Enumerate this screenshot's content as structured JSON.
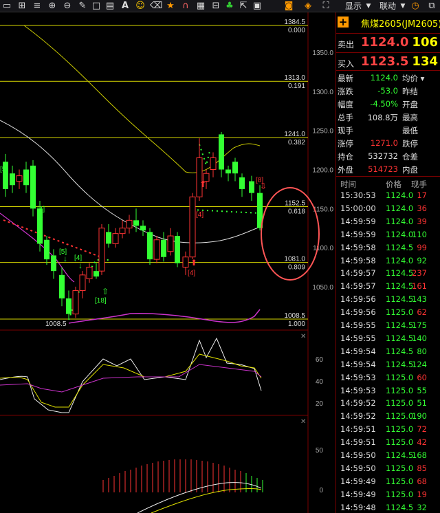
{
  "toolbar": {
    "icons": [
      "panel-icon",
      "grid-icon",
      "menu-icon",
      "zoom-in-icon",
      "zoom-out-icon",
      "pen-icon",
      "square-icon",
      "chart-icon",
      "font-icon",
      "smiley-icon",
      "eraser-icon",
      "star-icon",
      "magnet-icon",
      "calculator-icon",
      "club-icon",
      "export-icon",
      "grid-small-icon"
    ],
    "display_label": "显示",
    "link_label": "联动"
  },
  "colors": {
    "up": "#ff3333",
    "down": "#33ff33",
    "text_gray": "#dddddd",
    "yellow": "#ffff00",
    "grid": "#7a0000"
  },
  "chart": {
    "price_labels": [
      "1384.5",
      "1350.0",
      "1313.0",
      "1300.0",
      "1250.0",
      "1241.0",
      "1200.0",
      "1152.5",
      "1150.0",
      "1100.0",
      "1081.0",
      "1050.0",
      "1008.5"
    ],
    "fib_lines": [
      {
        "price": "1384.5",
        "ratio": "0.000"
      },
      {
        "price": "1313.0",
        "ratio": "0.191"
      },
      {
        "price": "1241.0",
        "ratio": "0.382"
      },
      {
        "price": "1152.5",
        "ratio": "0.618"
      },
      {
        "price": "1081.0",
        "ratio": "0.809"
      },
      {
        "price": "1008.5",
        "ratio": "1.000"
      }
    ],
    "low_label": "1008.5",
    "markers": [
      "[5]",
      "[4]",
      "[5]",
      "[4]",
      "[18]",
      "[4]",
      "[4]",
      "[8]"
    ],
    "kdj_ticks": [
      "60",
      "40",
      "20"
    ],
    "macd_ticks": [
      "50",
      "0"
    ]
  },
  "panel": {
    "title": "焦煤2605(JM2605)",
    "sell_label": "卖出",
    "sell_price": "1124.0",
    "sell_vol": "106",
    "buy_label": "买入",
    "buy_price": "1123.5",
    "buy_vol": "134",
    "stats": [
      {
        "l": "最新",
        "v": "1124.0",
        "r": "均价 ▾",
        "c": "#33ff33"
      },
      {
        "l": "涨跌",
        "v": "-53.0",
        "r": "昨结",
        "c": "#33ff33"
      },
      {
        "l": "幅度",
        "v": "-4.50%",
        "r": "开盘",
        "c": "#33ff33"
      },
      {
        "l": "总手",
        "v": "108.8万",
        "r": "最高",
        "c": "#dddddd"
      },
      {
        "l": "现手",
        "v": "",
        "r": "最低",
        "c": "#dddddd"
      },
      {
        "l": "涨停",
        "v": "1271.0",
        "r": "跌停",
        "c": "#ff3333"
      },
      {
        "l": "持仓",
        "v": "532732",
        "r": "仓差",
        "c": "#dddddd"
      },
      {
        "l": "外盘",
        "v": "514723",
        "r": "内盘",
        "c": "#ff3333"
      }
    ],
    "ticks_header": {
      "time": "时间",
      "price": "价格",
      "vol": "现手"
    },
    "ticks": [
      {
        "t": "15:30:53",
        "p": "1124.0",
        "v": "17",
        "pc": "#33ff33",
        "vc": "#ff3333"
      },
      {
        "t": "15:00:00",
        "p": "1124.0",
        "v": "36",
        "pc": "#33ff33",
        "vc": "#ff3333"
      },
      {
        "t": "14:59:59",
        "p": "1124.0",
        "v": "39",
        "pc": "#33ff33",
        "vc": "#ff3333"
      },
      {
        "t": "14:59:59",
        "p": "1124.0",
        "v": "110",
        "pc": "#33ff33",
        "vc": "#33ff33"
      },
      {
        "t": "14:59:58",
        "p": "1124.5",
        "v": "99",
        "pc": "#33ff33",
        "vc": "#ff3333"
      },
      {
        "t": "14:59:58",
        "p": "1124.0",
        "v": "92",
        "pc": "#33ff33",
        "vc": "#33ff33"
      },
      {
        "t": "14:59:57",
        "p": "1124.5",
        "v": "237",
        "pc": "#33ff33",
        "vc": "#ff3333"
      },
      {
        "t": "14:59:57",
        "p": "1124.5",
        "v": "161",
        "pc": "#33ff33",
        "vc": "#ff3333"
      },
      {
        "t": "14:59:56",
        "p": "1124.5",
        "v": "143",
        "pc": "#33ff33",
        "vc": "#33ff33"
      },
      {
        "t": "14:59:56",
        "p": "1125.0",
        "v": "62",
        "pc": "#33ff33",
        "vc": "#ff3333"
      },
      {
        "t": "14:59:55",
        "p": "1124.5",
        "v": "175",
        "pc": "#33ff33",
        "vc": "#33ff33"
      },
      {
        "t": "14:59:55",
        "p": "1124.5",
        "v": "140",
        "pc": "#33ff33",
        "vc": "#33ff33"
      },
      {
        "t": "14:59:54",
        "p": "1124.5",
        "v": "80",
        "pc": "#33ff33",
        "vc": "#33ff33"
      },
      {
        "t": "14:59:54",
        "p": "1124.5",
        "v": "124",
        "pc": "#33ff33",
        "vc": "#33ff33"
      },
      {
        "t": "14:59:53",
        "p": "1125.0",
        "v": "60",
        "pc": "#33ff33",
        "vc": "#ff3333"
      },
      {
        "t": "14:59:53",
        "p": "1125.0",
        "v": "55",
        "pc": "#33ff33",
        "vc": "#33ff33"
      },
      {
        "t": "14:59:52",
        "p": "1125.0",
        "v": "51",
        "pc": "#33ff33",
        "vc": "#33ff33"
      },
      {
        "t": "14:59:52",
        "p": "1125.0",
        "v": "190",
        "pc": "#33ff33",
        "vc": "#33ff33"
      },
      {
        "t": "14:59:51",
        "p": "1125.0",
        "v": "72",
        "pc": "#33ff33",
        "vc": "#ff3333"
      },
      {
        "t": "14:59:51",
        "p": "1125.0",
        "v": "42",
        "pc": "#33ff33",
        "vc": "#ff3333"
      },
      {
        "t": "14:59:50",
        "p": "1124.5",
        "v": "168",
        "pc": "#33ff33",
        "vc": "#33ff33"
      },
      {
        "t": "14:59:50",
        "p": "1125.0",
        "v": "85",
        "pc": "#33ff33",
        "vc": "#ff3333"
      },
      {
        "t": "14:59:49",
        "p": "1125.0",
        "v": "68",
        "pc": "#33ff33",
        "vc": "#ff3333"
      },
      {
        "t": "14:59:49",
        "p": "1125.0",
        "v": "19",
        "pc": "#33ff33",
        "vc": "#ff3333"
      },
      {
        "t": "14:59:48",
        "p": "1124.5",
        "v": "32",
        "pc": "#33ff33",
        "vc": "#33ff33"
      }
    ]
  }
}
